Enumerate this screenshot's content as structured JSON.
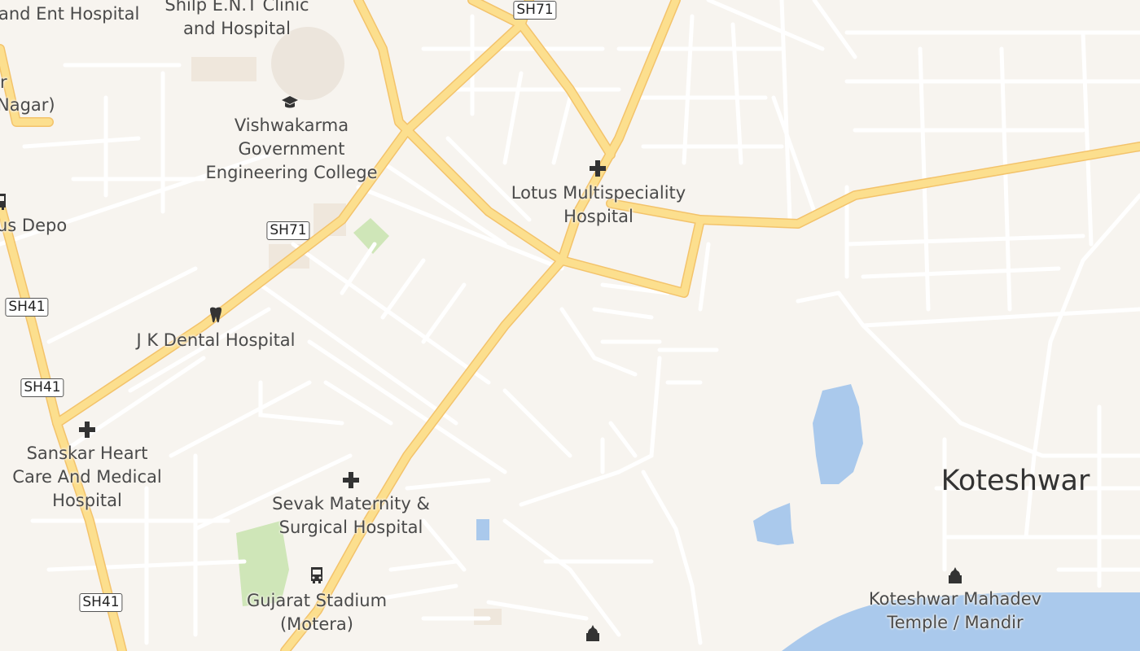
{
  "map": {
    "colors": {
      "background": "#f7f4ef",
      "minor_road": "#ffffff",
      "major_road": "#fcdf8e",
      "major_road_casing": "#f3c36b",
      "water": "#aac9ec",
      "park": "#cfe6b8"
    },
    "places": [
      {
        "id": "ent-hospital",
        "lines": [
          "and Ent Hospital"
        ]
      },
      {
        "id": "shilp-ent",
        "lines": [
          "Shilp E.N.T Clinic",
          "and Hospital"
        ]
      },
      {
        "id": "r-fragment",
        "lines": [
          "r"
        ]
      },
      {
        "id": "nagar-fragment",
        "lines": [
          "Nagar)"
        ]
      },
      {
        "id": "vishwakarma",
        "lines": [
          "Vishwakarma",
          "Government",
          "Engineering College"
        ]
      },
      {
        "id": "lotus",
        "lines": [
          "Lotus Multispeciality",
          "Hospital"
        ]
      },
      {
        "id": "bus-depo",
        "lines": [
          "us Depo"
        ]
      },
      {
        "id": "jk-dental",
        "lines": [
          "J K Dental Hospital"
        ]
      },
      {
        "id": "sanskar",
        "lines": [
          "Sanskar Heart",
          "Care And Medical",
          "Hospital"
        ]
      },
      {
        "id": "sevak",
        "lines": [
          "Sevak Maternity &",
          "Surgical Hospital"
        ]
      },
      {
        "id": "gujarat-stadium",
        "lines": [
          "Gujarat Stadium",
          "(Motera)"
        ]
      },
      {
        "id": "koteshwar",
        "lines": [
          "Koteshwar"
        ]
      },
      {
        "id": "koteshwar-temple",
        "lines": [
          "Koteshwar Mahadev",
          "Temple / Mandir"
        ]
      }
    ],
    "shields": [
      {
        "id": "sh71-top",
        "text": "SH71"
      },
      {
        "id": "sh71-mid",
        "text": "SH71"
      },
      {
        "id": "sh41-a",
        "text": "SH41"
      },
      {
        "id": "sh41-b",
        "text": "SH41"
      },
      {
        "id": "sh41-c",
        "text": "SH41"
      }
    ],
    "icons": [
      "education-icon",
      "hospital-icon",
      "hospital-icon",
      "hospital-icon",
      "dentist-icon",
      "bus-icon",
      "bus-icon",
      "temple-icon",
      "temple-icon"
    ]
  }
}
